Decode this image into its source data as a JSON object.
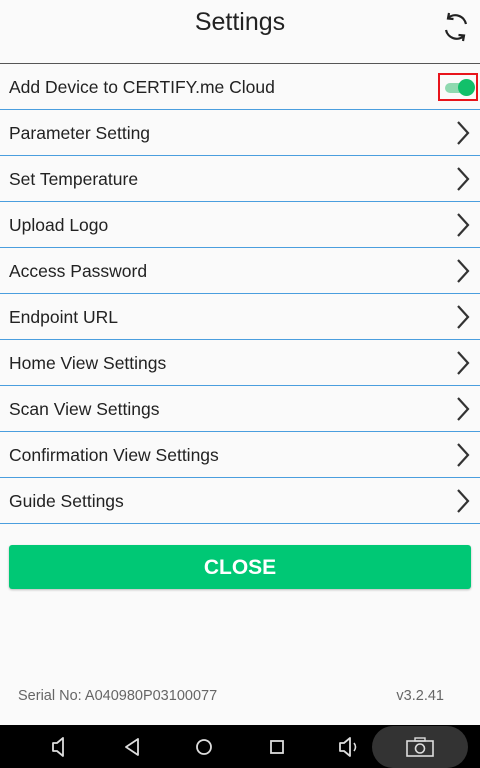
{
  "header": {
    "title": "Settings",
    "refresh_icon": "refresh-icon"
  },
  "settings": {
    "items": [
      {
        "label": "Add Device to CERTIFY.me Cloud",
        "control": "toggle",
        "on": true
      },
      {
        "label": "Parameter Setting",
        "control": "chevron"
      },
      {
        "label": "Set Temperature",
        "control": "chevron"
      },
      {
        "label": "Upload Logo",
        "control": "chevron"
      },
      {
        "label": "Access Password",
        "control": "chevron"
      },
      {
        "label": "Endpoint URL",
        "control": "chevron"
      },
      {
        "label": "Home View Settings",
        "control": "chevron"
      },
      {
        "label": "Scan View Settings",
        "control": "chevron"
      },
      {
        "label": "Confirmation View Settings",
        "control": "chevron"
      },
      {
        "label": "Guide Settings",
        "control": "chevron"
      }
    ]
  },
  "close_button": {
    "label": "CLOSE"
  },
  "footer": {
    "serial": "Serial No: A040980P03100077",
    "version": "v3.2.41"
  },
  "navbar": {
    "icons": [
      "volume-down-icon",
      "back-icon",
      "home-icon",
      "recents-icon",
      "volume-up-icon",
      "screenshot-icon"
    ]
  },
  "colors": {
    "accent": "#00c875",
    "divider": "#4a9ede",
    "highlight_box": "#e8141c"
  }
}
